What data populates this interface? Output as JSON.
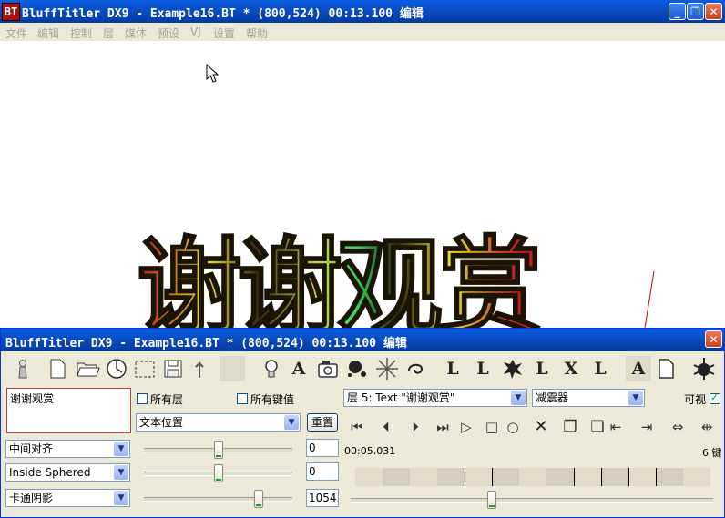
{
  "window": {
    "title": "BluffTitler DX9 - Example16.BT * (800,524) 00:13.100 编辑",
    "app_icon": "BT"
  },
  "menu": [
    "文件",
    "编辑",
    "控制",
    "层",
    "媒体",
    "预设",
    "VJ",
    "设置",
    "帮助"
  ],
  "canvas": {
    "text": "谢谢观赏"
  },
  "dialog": {
    "title": "BluffTitler DX9 - Example16.BT * (800,524) 00:13.100 编辑",
    "text_input": "谢谢观赏",
    "all_layers_label": "所有层",
    "all_layers_checked": false,
    "all_keys_label": "所有键值",
    "all_keys_checked": false,
    "property_select": "文本位置",
    "reset_button": "重置",
    "layer_select": "层 5: Text \"谢谢观赏\"",
    "effect_select": "减震器",
    "visible_label": "可视",
    "visible_checked": true,
    "align_select": "中间对齐",
    "style_select": "Inside Sphered",
    "shadow_select": "卡通阴影",
    "value1": "0",
    "value2": "0",
    "value3": "1054.6",
    "slider1_pct": 50,
    "slider2_pct": 50,
    "slider3_pct": 77,
    "time": "00:05.031",
    "keys_count": "6 键",
    "timeline_pos_pct": 39,
    "toolbar_icons": [
      "torch-icon",
      "new-file-icon",
      "open-folder-icon",
      "clock-icon",
      "select-area-icon",
      "save-icon",
      "undo-icon",
      "blank-icon",
      "light-icon",
      "text-layer-icon",
      "camera-icon",
      "particles-icon",
      "star-burst-icon",
      "spiral-icon",
      "letter-l-icon",
      "letter-l-sparkle-icon",
      "splat-icon",
      "letter-l-small-icon",
      "letter-x-icon",
      "letter-l-shadow-icon",
      "letter-a-icon",
      "page-icon",
      "bug-icon"
    ],
    "toolbar_letters": [
      "A",
      "L",
      "L",
      "L",
      "X",
      "L",
      "A"
    ],
    "playback_icons": [
      "go-start-icon",
      "prev-key-icon",
      "next-key-icon",
      "go-end-icon",
      "play-icon",
      "stop-icon",
      "record-icon",
      "delete-key-icon",
      "copy-key-icon",
      "paste-key-icon",
      "move-left-icon",
      "move-right-icon",
      "move-both-icon",
      "move-split-icon"
    ],
    "playback_glyphs": [
      "⏮",
      "⏴",
      "⏵",
      "⏭",
      "▷",
      "□",
      "○",
      "✕",
      "❐",
      "❏",
      "⇤",
      "⇥",
      "⇔",
      "⇹"
    ]
  }
}
